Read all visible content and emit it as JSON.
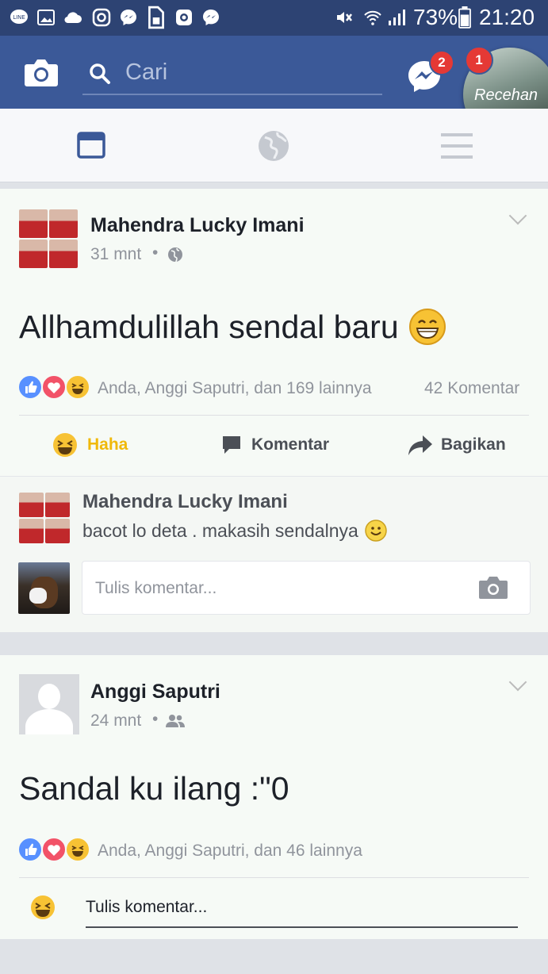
{
  "status_bar": {
    "battery": "73%",
    "time": "21:20",
    "icons": [
      "line-icon",
      "gallery-icon",
      "cloud-icon",
      "instagram-icon",
      "messenger-icon",
      "sim-icon",
      "camera-app-icon",
      "messenger-icon",
      "mute-icon",
      "wifi-icon",
      "signal-icon",
      "battery-icon"
    ]
  },
  "header": {
    "search_placeholder": "Cari",
    "messenger_badge": "2",
    "notification_badge": "1",
    "story_label": "Recehan"
  },
  "posts": [
    {
      "author": "Mahendra Lucky Imani",
      "time": "31 mnt",
      "privacy": "globe-icon",
      "text": "Allhamdulillah sendal baru",
      "reactions_text": "Anda, Anggi Saputri, dan 169 lainnya",
      "comments_count": "42 Komentar",
      "actions": {
        "haha": "Haha",
        "comment": "Komentar",
        "share": "Bagikan"
      },
      "comment": {
        "author": "Mahendra Lucky Imani",
        "text": "bacot lo deta . makasih sendalnya"
      },
      "comment_placeholder": "Tulis komentar..."
    },
    {
      "author": "Anggi Saputri",
      "time": "24 mnt",
      "privacy": "friends-icon",
      "text": "Sandal ku ilang :\"0",
      "reactions_text": "Anda, Anggi Saputri, dan 46 lainnya",
      "comment_placeholder": "Tulis komentar..."
    }
  ],
  "colors": {
    "brand_blue": "#3b5998",
    "status_blue": "#2d4373",
    "haha_yellow": "#f0b90b",
    "badge_red": "#e53935"
  }
}
